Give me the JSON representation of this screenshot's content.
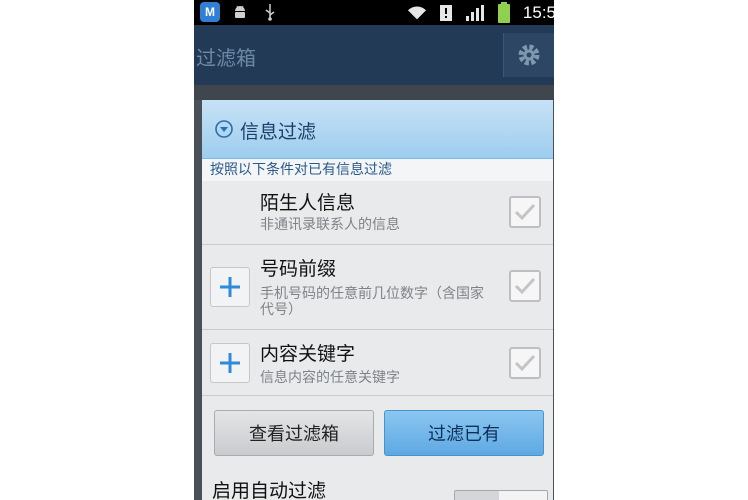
{
  "status_bar": {
    "app_badge": "M",
    "time": "15:5"
  },
  "app_bar": {
    "title": "过滤箱"
  },
  "dialog": {
    "title": "信息过滤",
    "subheader": "按照以下条件对已有信息过滤",
    "items": [
      {
        "title": "陌生人信息",
        "desc": "非通讯录联系人的信息",
        "checked": false
      },
      {
        "title": "号码前缀",
        "desc": "手机号码的任意前几位数字（含国家代号）",
        "checked": false
      },
      {
        "title": "内容关键字",
        "desc": "信息内容的任意关键字",
        "checked": false
      }
    ],
    "buttons": {
      "view_box": "查看过滤箱",
      "filter_existing": "过滤已有"
    },
    "auto_filter": {
      "label": "启用自动过滤"
    }
  },
  "colors": {
    "accent": "#5ea9e3",
    "header": "#9ecdee",
    "app_bar": "#223a55"
  }
}
